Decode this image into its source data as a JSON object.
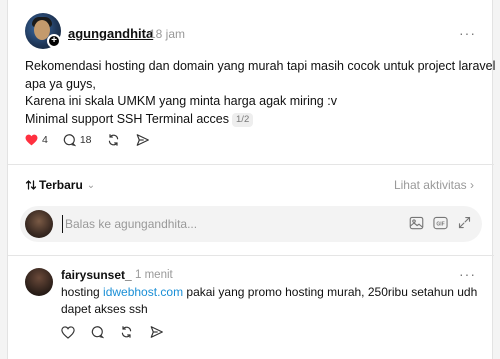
{
  "post": {
    "username": "agungandhita",
    "time": "18 jam",
    "more": "···",
    "lines": [
      "Rekomendasi hosting dan domain yang murah tapi masih cocok untuk project laravel",
      "apa ya guys,",
      "Karena ini skala UMKM yang minta harga agak miring :v",
      "Minimal support SSH Terminal acces"
    ],
    "page_chip": "1/2",
    "likes": "4",
    "comments": "18",
    "like_color": "#ff3040"
  },
  "sort": {
    "label": "Terbaru",
    "activity": "Lihat aktivitas"
  },
  "reply": {
    "placeholder": "Balas ke agungandhita..."
  },
  "comment": {
    "username": "fairysunset_",
    "time": "1 menit",
    "more": "···",
    "text_before": "hosting ",
    "link": "idwebhost.com",
    "text_after": " pakai yang promo hosting murah, 250ribu setahun udh dapet akses ssh"
  },
  "icons": {
    "like": "heart-icon",
    "comment": "comment-bubble-icon",
    "repost": "repost-icon",
    "share": "send-icon",
    "sort": "sort-arrows-icon",
    "image": "image-icon",
    "gif": "gif-icon",
    "expand": "expand-icon"
  }
}
